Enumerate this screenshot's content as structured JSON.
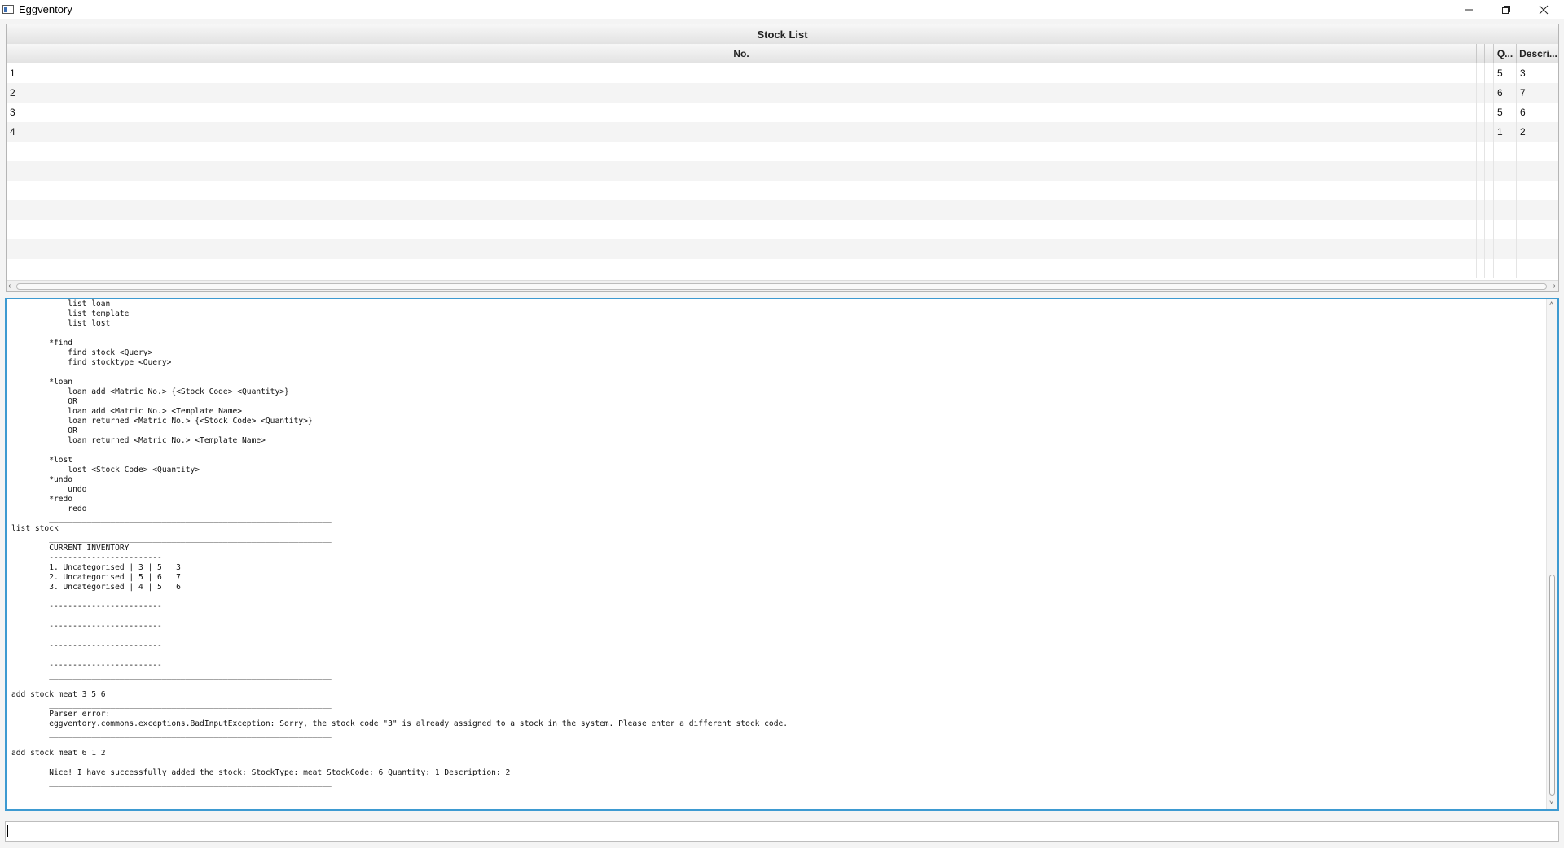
{
  "window": {
    "title": "Eggventory"
  },
  "table": {
    "title": "Stock List",
    "columns": [
      "No.",
      "",
      "",
      "Q...",
      "Descri..."
    ],
    "rows": [
      [
        "1",
        "",
        "",
        "5",
        "3"
      ],
      [
        "2",
        "",
        "",
        "6",
        "7"
      ],
      [
        "3",
        "",
        "",
        "5",
        "6"
      ],
      [
        "4",
        "",
        "",
        "1",
        "2"
      ],
      [
        "",
        "",
        "",
        "",
        ""
      ],
      [
        "",
        "",
        "",
        "",
        ""
      ],
      [
        "",
        "",
        "",
        "",
        ""
      ],
      [
        "",
        "",
        "",
        "",
        ""
      ],
      [
        "",
        "",
        "",
        "",
        ""
      ],
      [
        "",
        "",
        "",
        "",
        ""
      ],
      [
        "",
        "",
        "",
        "",
        ""
      ]
    ]
  },
  "console": {
    "lines": [
      "            list loan",
      "            list template",
      "            list lost",
      "",
      "        *find",
      "            find stock <Query>",
      "            find stocktype <Query>",
      "",
      "        *loan",
      "            loan add <Matric No.> {<Stock Code> <Quantity>}",
      "            OR",
      "            loan add <Matric No.> <Template Name>",
      "            loan returned <Matric No.> {<Stock Code> <Quantity>}",
      "            OR",
      "            loan returned <Matric No.> <Template Name>",
      "",
      "        *lost",
      "            lost <Stock Code> <Quantity>",
      "        *undo",
      "            undo",
      "        *redo",
      "            redo",
      "        ____________________________________________________________",
      "list stock",
      "        ____________________________________________________________",
      "        CURRENT INVENTORY",
      "        ------------------------",
      "        1. Uncategorised | 3 | 5 | 3",
      "        2. Uncategorised | 5 | 6 | 7",
      "        3. Uncategorised | 4 | 5 | 6",
      "",
      "        ------------------------",
      "",
      "        ------------------------",
      "",
      "        ------------------------",
      "",
      "        ------------------------",
      "        ____________________________________________________________",
      "",
      "add stock meat 3 5 6",
      "        ____________________________________________________________",
      "        Parser error:",
      "        eggventory.commons.exceptions.BadInputException: Sorry, the stock code \"3\" is already assigned to a stock in the system. Please enter a different stock code.",
      "        ____________________________________________________________",
      "",
      "add stock meat 6 1 2",
      "        ____________________________________________________________",
      "        Nice! I have successfully added the stock: StockType: meat StockCode: 6 Quantity: 1 Description: 2",
      "        ____________________________________________________________"
    ]
  },
  "command_input": {
    "value": ""
  }
}
